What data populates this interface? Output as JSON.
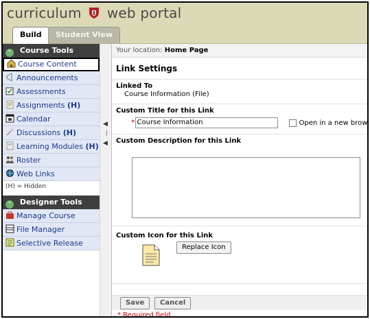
{
  "header": {
    "logo_left": "curriculum",
    "logo_right": "web portal",
    "tabs": [
      {
        "label": "Build",
        "active": true
      },
      {
        "label": "Student View",
        "active": false
      }
    ]
  },
  "sidebar": {
    "course_tools_title": "Course Tools",
    "course_tools": [
      {
        "label": "Course Content",
        "icon": "home-icon"
      },
      {
        "label": "Announcements",
        "icon": "megaphone-icon"
      },
      {
        "label": "Assessments",
        "icon": "assessment-icon"
      },
      {
        "label": "Assignments",
        "suffix": "(H)",
        "icon": "assignment-icon"
      },
      {
        "label": "Calendar",
        "icon": "calendar-icon"
      },
      {
        "label": "Discussions",
        "suffix": "(H)",
        "icon": "discussion-icon"
      },
      {
        "label": "Learning Modules",
        "suffix": "(H)",
        "icon": "module-icon"
      },
      {
        "label": "Roster",
        "icon": "people-icon"
      },
      {
        "label": "Web Links",
        "icon": "globe-icon"
      }
    ],
    "hidden_note": "(H) = Hidden",
    "designer_tools_title": "Designer Tools",
    "designer_tools": [
      {
        "label": "Manage Course",
        "icon": "toolbox-icon"
      },
      {
        "label": "File Manager",
        "icon": "file-manager-icon"
      },
      {
        "label": "Selective Release",
        "icon": "release-icon"
      }
    ]
  },
  "main": {
    "location_label": "Your location:",
    "location_value": "Home Page",
    "page_title": "Link Settings",
    "linked_to_label": "Linked To",
    "linked_to_value": "Course Information (File)",
    "custom_title_label": "Custom Title for this Link",
    "custom_title_value": "Course Information",
    "open_new_window_label": "Open in a new brow",
    "custom_description_label": "Custom Description for this Link",
    "custom_icon_label": "Custom Icon for this Link",
    "replace_icon_button": "Replace Icon",
    "save_button": "Save",
    "cancel_button": "Cancel",
    "required_note": "* Required field",
    "required_star": "*"
  },
  "colors": {
    "header_bg": "#dcd9b6",
    "sidebar_head": "#3f3f3f",
    "nav_item_bg": "#e1e7f4",
    "link_text": "#1a3a8f",
    "required": "#cc0000"
  }
}
